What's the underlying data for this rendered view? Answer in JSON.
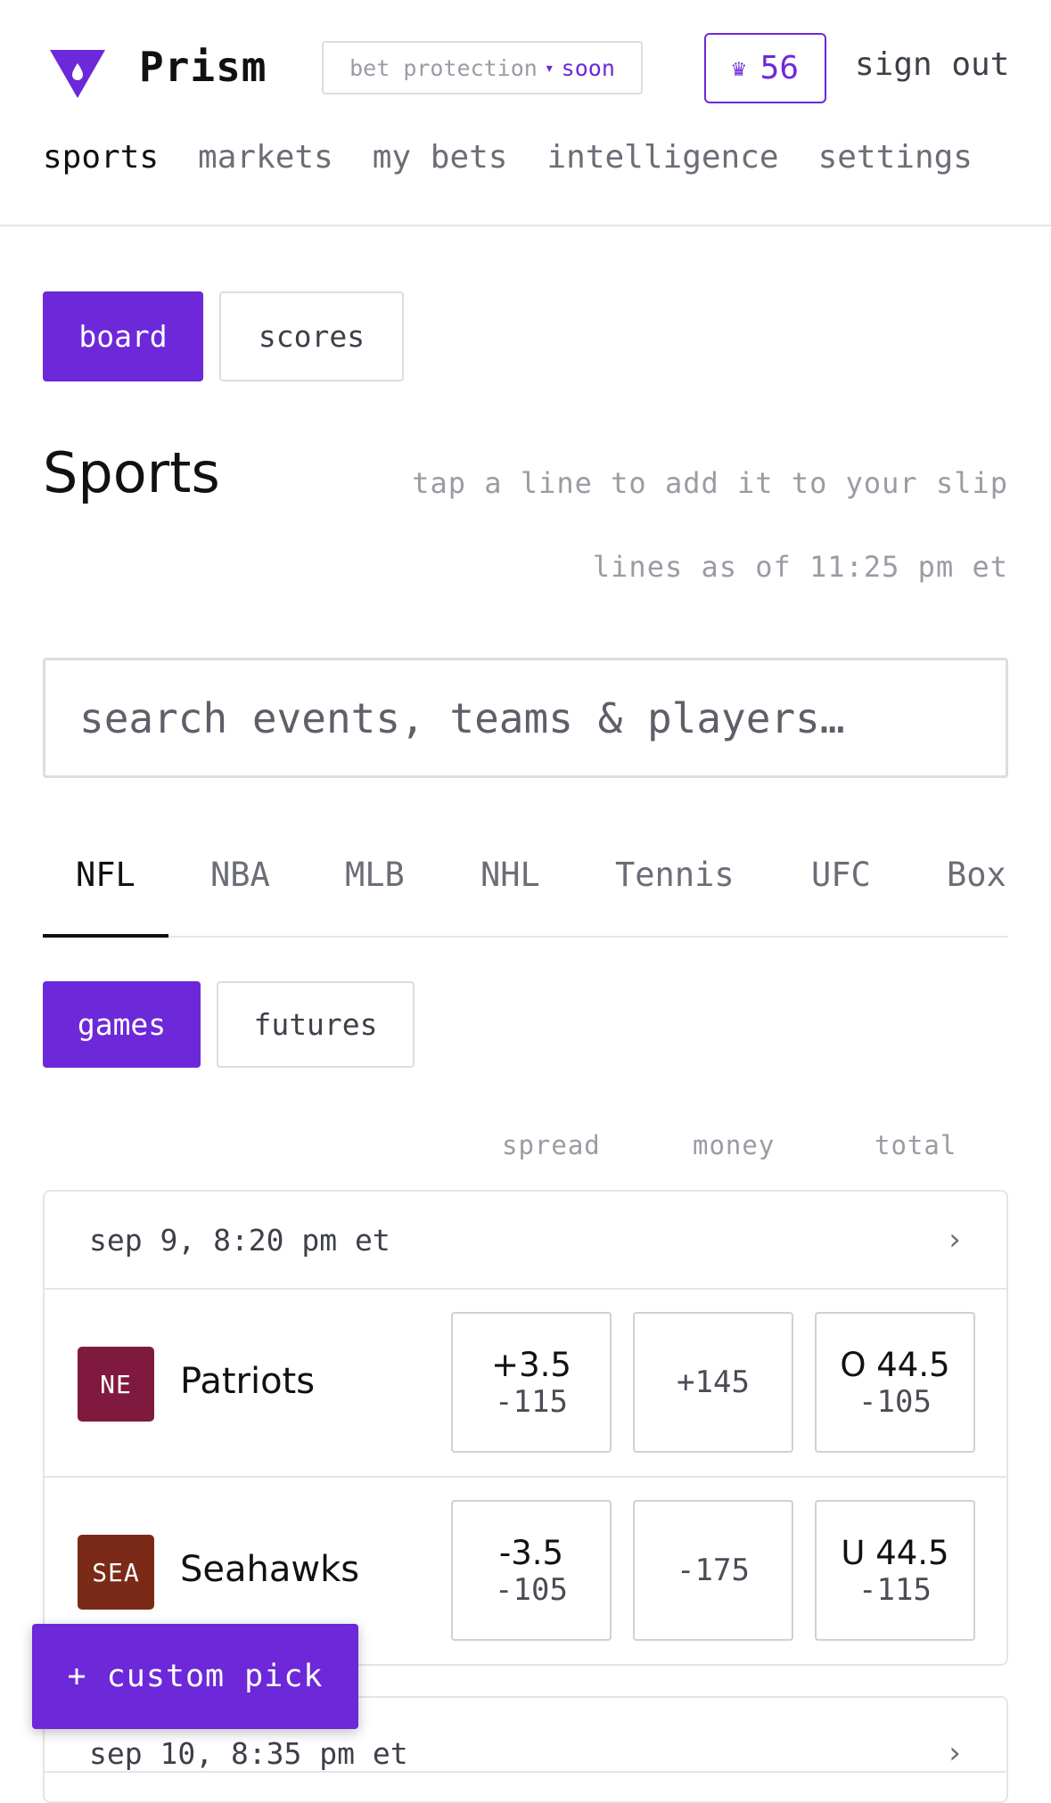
{
  "header": {
    "brand": "Prism",
    "bet_protection_label": "bet protection",
    "bet_protection_status": "soon",
    "credits": "56",
    "sign_out": "sign out",
    "brand_color": "#6d28d9"
  },
  "nav": [
    "sports",
    "markets",
    "my bets",
    "intelligence",
    "settings"
  ],
  "view_toggle": {
    "board": "board",
    "scores": "scores"
  },
  "page": {
    "title": "Sports",
    "hint": "tap a line to add it to your slip",
    "lines_as_of": "lines as of 11:25 pm et"
  },
  "search": {
    "placeholder": "search events, teams & players…"
  },
  "leagues": [
    "NFL",
    "NBA",
    "MLB",
    "NHL",
    "Tennis",
    "UFC",
    "Box"
  ],
  "market_toggle": {
    "games": "games",
    "futures": "futures"
  },
  "columns": {
    "spread": "spread",
    "money": "money",
    "total": "total"
  },
  "games": [
    {
      "time": "sep 9, 8:20 pm et",
      "teams": [
        {
          "abbr": "NE",
          "name": "Patriots",
          "color": "#7f1a3e",
          "spread_line": "+3.5",
          "spread_price": "-115",
          "money": "+145",
          "total_line": "O 44.5",
          "total_price": "-105"
        },
        {
          "abbr": "SEA",
          "name": "Seahawks",
          "color": "#7a2a17",
          "spread_line": "-3.5",
          "spread_price": "-105",
          "money": "-175",
          "total_line": "U 44.5",
          "total_price": "-115"
        }
      ]
    },
    {
      "time": "sep 10, 8:35 pm et"
    }
  ],
  "fab": {
    "label": "+ custom pick"
  }
}
